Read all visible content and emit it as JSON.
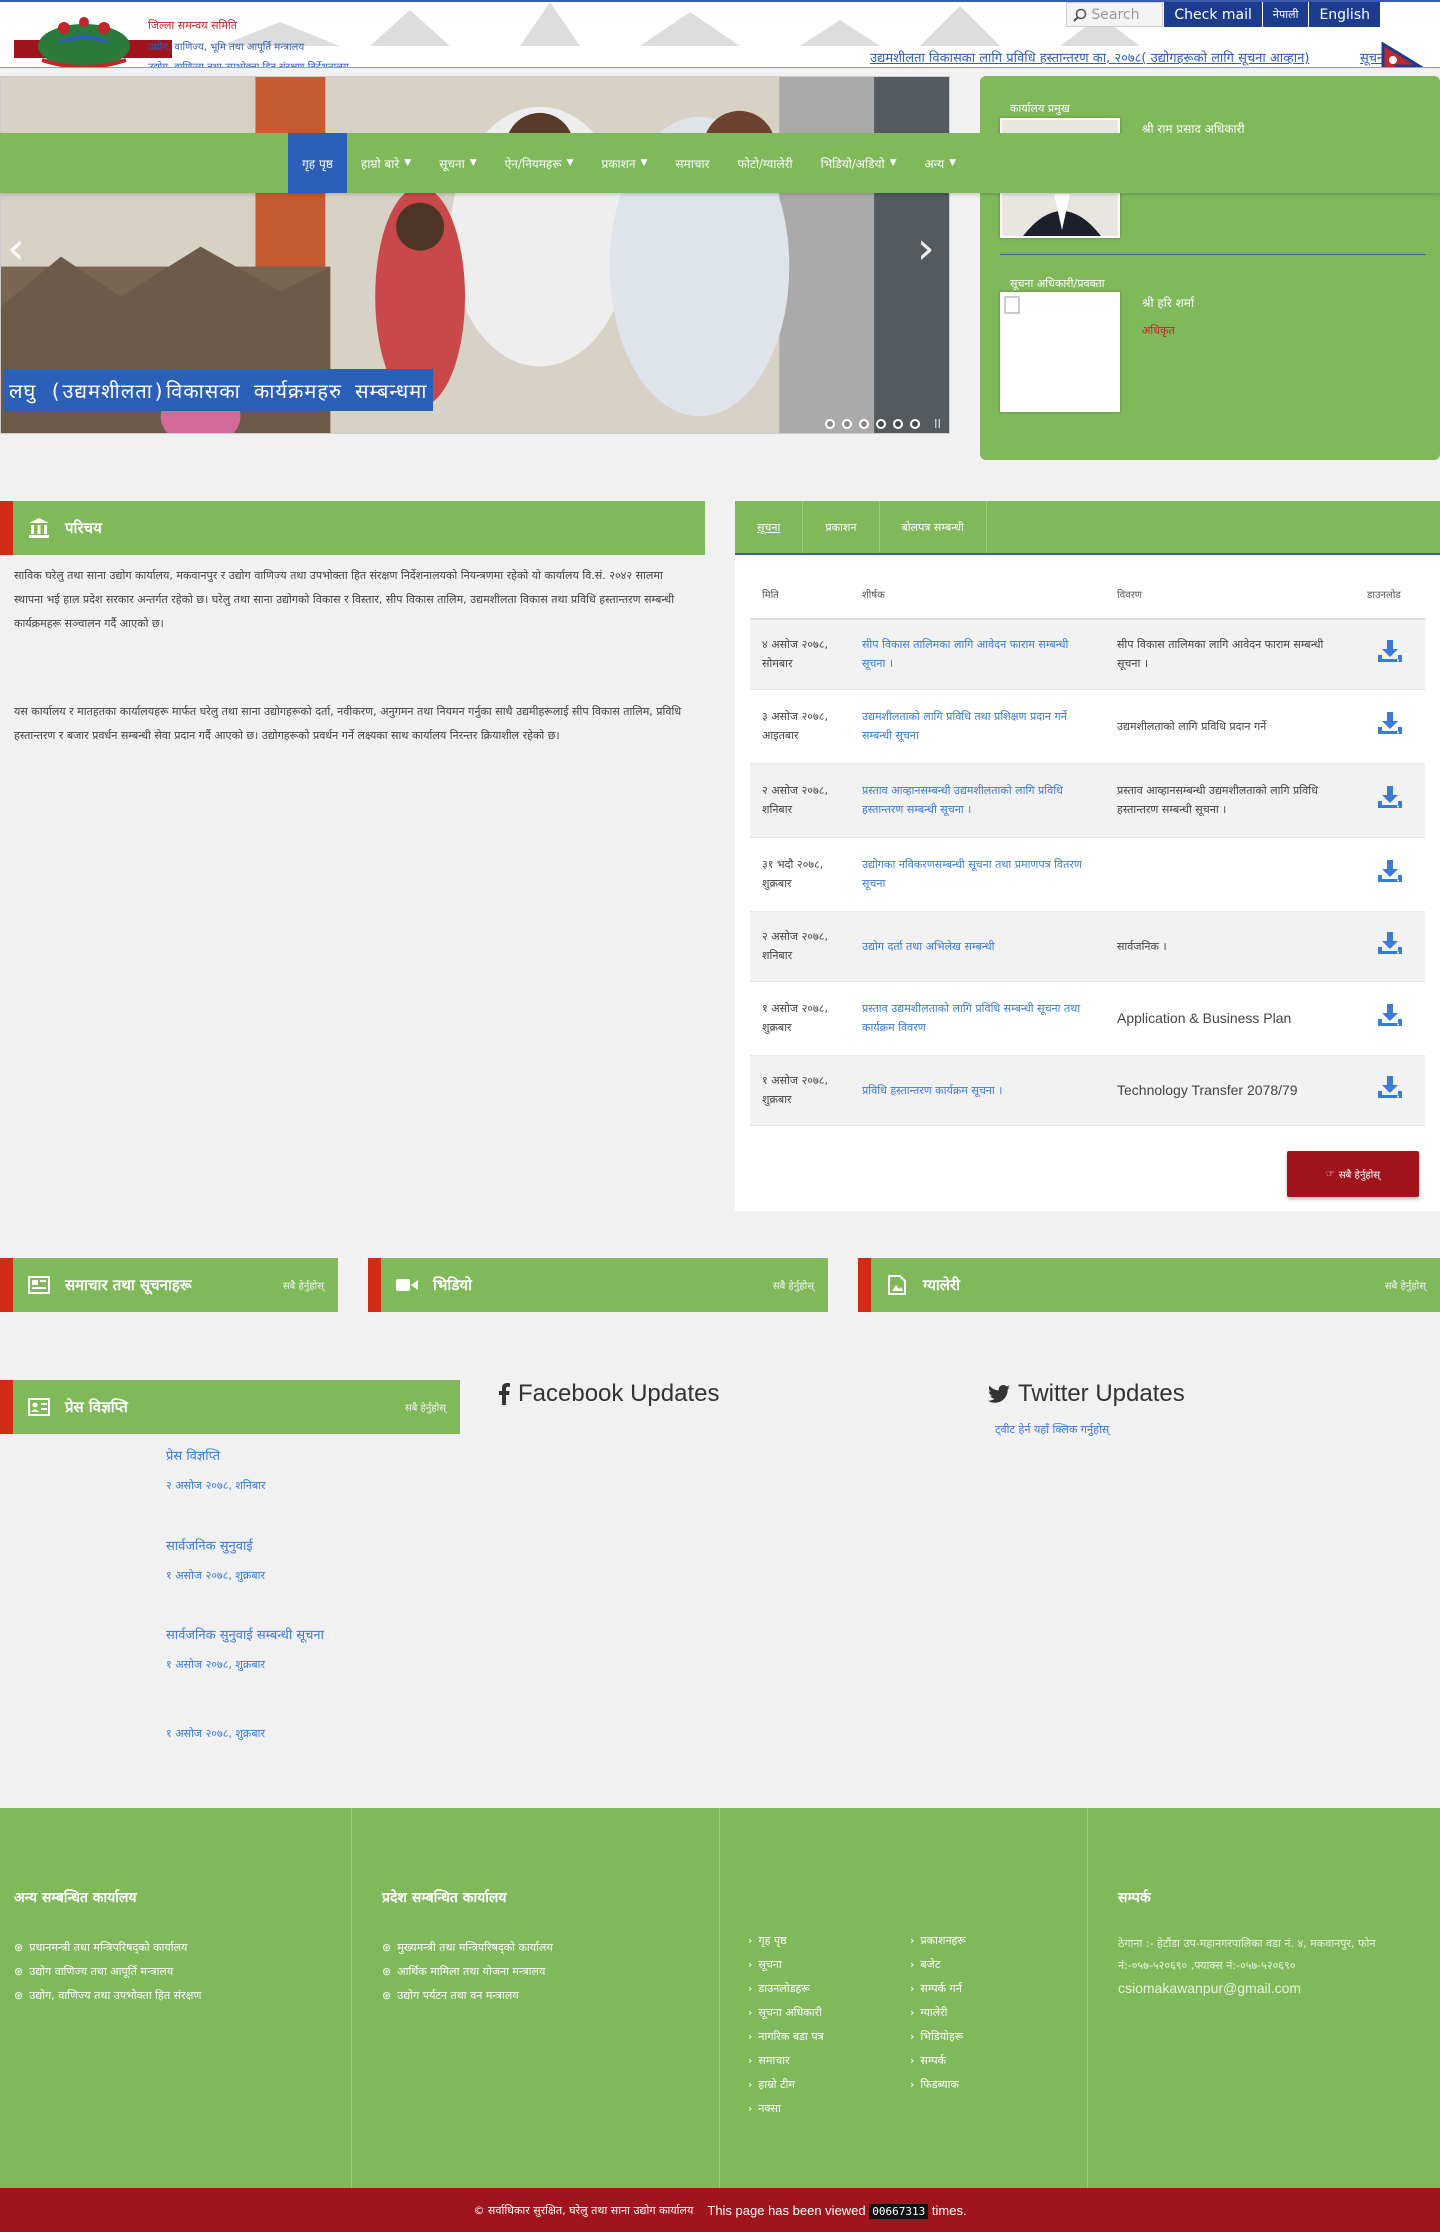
{
  "header": {
    "office_name": "जिल्ला समन्वय समिति",
    "office_sub1": "उद्योग, वाणिज्य, भूमि तथा आपूर्ति मन्त्रालय",
    "office_sub2": "उद्योग, वाणिज्य तथा उपभोक्ता हित संरक्षण निर्देशनालय",
    "search_placeholder": "Search",
    "check_mail": "Check mail",
    "lang_np": "नेपाली",
    "lang_en": "English",
    "ticker": "उद्यमशीलता विकासका लागि प्रविधि हस्तान्तरण का, २०७८( उद्योगहरूको लागि सूचना आव्हान)",
    "ticker2": "सूचना"
  },
  "nav": {
    "items": [
      {
        "label": "गृह पृष्ठ",
        "caret": false,
        "active": true
      },
      {
        "label": "हाम्रो बारे",
        "caret": true,
        "active": false
      },
      {
        "label": "सूचना",
        "caret": true,
        "active": false
      },
      {
        "label": "ऐन/नियमहरू",
        "caret": true,
        "active": false
      },
      {
        "label": "प्रकाशन",
        "caret": true,
        "active": false
      },
      {
        "label": "समाचार",
        "caret": false,
        "active": false
      },
      {
        "label": "फोटो/ग्यालेरी",
        "caret": false,
        "active": false
      },
      {
        "label": "भिडियो/अडियो",
        "caret": true,
        "active": false
      },
      {
        "label": "अन्य",
        "caret": true,
        "active": false
      }
    ]
  },
  "slider": {
    "caption": "लघु (उद्यमशीलता)विकासका कार्यक्रमहरु सम्बन्धमा",
    "prev_icon": "‹",
    "next_icon": "›",
    "pause_icon": "II"
  },
  "officials": [
    {
      "role": "कार्यालय प्रमुख",
      "name": "श्री राम प्रसाद अधिकारी",
      "title": ""
    },
    {
      "role": "सूचना अधिकारी/प्रवक्ता",
      "name": "श्री हरि शर्मा",
      "title": "अधिकृत"
    }
  ],
  "intro": {
    "title": "परिचय",
    "p1": "साविक घरेलु तथा साना उद्योग कार्यालय, मकवानपुर र उद्योग वाणिज्य तथा उपभोक्ता हित संरक्षण निर्देशनालयको नियन्त्रणमा रहेको यो कार्यालय वि.सं. २०४२ सालमा स्थापना भई हाल प्रदेश सरकार अन्तर्गत रहेको छ। घरेलु तथा साना उद्योगको विकास र विस्तार, सीप विकास तालिम, उद्यमशीलता विकास तथा प्रविधि हस्तान्तरण सम्बन्धी कार्यक्रमहरू सञ्चालन गर्दै आएको छ।",
    "p2": "यस कार्यालय र मातहतका कार्यालयहरू मार्फत घरेलु तथा साना उद्योगहरूको दर्ता, नवीकरण, अनुगमन तथा नियमन गर्नुका साथै उद्यमीहरूलाई सीप विकास तालिम, प्रविधि हस्तान्तरण र बजार प्रवर्धन सम्बन्धी सेवा प्रदान गर्दै आएको छ। उद्योगहरूको प्रवर्धन गर्ने लक्ष्यका साथ कार्यालय निरन्तर क्रियाशील रहेको छ।"
  },
  "docs": {
    "tabs": [
      "सूचना",
      "प्रकाशन",
      "बोलपत्र सम्बन्धी"
    ],
    "headers": [
      "मिति",
      "शीर्षक",
      "विवरण",
      "डाउनलोड"
    ],
    "rows": [
      {
        "date": "४ असोज २०७८, सोमबार",
        "title": "सीप विकास तालिमका लागि आवेदन फाराम सम्बन्धी सूचना ।",
        "desc": "सीप विकास तालिमका लागि आवेदन फाराम सम्बन्धी सूचना ।"
      },
      {
        "date": "३ असोज २०७८, आइतबार",
        "title": "उद्यमशीलताको लागि प्रविधि तथा प्रशिक्षण प्रदान गर्ने सम्बन्धी सूचना",
        "desc": "उद्यमशीलताको लागि प्रविधि प्रदान गर्ने"
      },
      {
        "date": "२ असोज २०७८, शनिबार",
        "title": "प्रस्ताव आव्हानसम्बन्धी उद्यमशीलताको लागि प्रविधि हस्तान्तरण सम्बन्धी सूचना ।",
        "desc": "प्रस्ताव आव्हानसम्बन्धी उद्यमशीलताको लागि प्रविधि हस्तान्तरण सम्बन्धी सूचना ।"
      },
      {
        "date": "३१ भदौ २०७८, शुक्रबार",
        "title": "उद्योगका नविकरणसम्बन्धी सूचना तथा प्रमाणपत्र वितरण सूचना",
        "desc": ""
      },
      {
        "date": "२ असोज २०७८, शनिबार",
        "title": "उद्योग दर्ता तथा अभिलेख सम्बन्धी",
        "desc": "सार्वजनिक ।"
      },
      {
        "date": "१ असोज २०७८, शुक्रबार",
        "title": "प्रस्ताव उद्यमशीलताको लागि प्रविधि सम्बन्धी सूचना तथा कार्यक्रम विवरण",
        "desc": "Application & Business Plan"
      },
      {
        "date": "१ असोज २०७८, शुक्रबार",
        "title": "प्रविधि हस्तान्तरण कार्यक्रम सूचना ।",
        "desc": "Technology Transfer 2078/79"
      }
    ],
    "view_all": "सबै हेर्नुहोस्"
  },
  "news": {
    "title": "समाचार तथा सूचनाहरू",
    "more": "सबै हेर्नुहोस्"
  },
  "video": {
    "title": "भिडियो",
    "more": "सबै हेर्नुहोस्"
  },
  "gallery": {
    "title": "ग्यालेरी",
    "more": "सबै हेर्नुहोस्"
  },
  "press": {
    "title": "प्रेस विज्ञप्ति",
    "more": "सबै हेर्नुहोस्",
    "items": [
      {
        "title": "प्रेस विज्ञप्ति",
        "date": "२ असोज २०७८, शनिबार"
      },
      {
        "title": "सार्वजनिक सुनुवाई",
        "date": "१ असोज २०७८, शुक्रबार"
      },
      {
        "title": "सार्वजनिक सुनुवाई सम्बन्धी सूचना",
        "date": "१ असोज २०७८, शुक्रबार"
      },
      {
        "title": "",
        "date": "१ असोज २०७८, शुक्रबार"
      }
    ]
  },
  "facebook": {
    "title": "Facebook Updates"
  },
  "twitter": {
    "title": "Twitter Updates",
    "link": "ट्वीट हेर्न यहाँ क्लिक गर्नुहोस्"
  },
  "footer": {
    "col1_title": "अन्य सम्बन्धित कार्यालय",
    "col1_links": [
      "प्रधानमन्त्री तथा मन्त्रिपरिषद्को कार्यालय",
      "उद्योग वाणिज्य तथा आपूर्ति मन्त्रालय",
      "उद्योग, वाणिज्य तथा उपभोक्ता हित संरक्षण"
    ],
    "col2_title": "प्रदेश सम्बन्धित कार्यालय",
    "col2_links": [
      "मुख्यमन्त्री तथा मन्त्रिपरिषद्को कार्यालय",
      "आर्थिक मामिला तथा योजना मन्त्रालय",
      "उद्योग पर्यटन तथा वन मन्त्रालय"
    ],
    "col3_links": [
      "गृह पृष्ठ",
      "सूचना",
      "डाउनलोडहरू",
      "सूचना अधिकारी",
      "नागरिक बडा पत्र",
      "समाचार",
      "हाम्रो टीम",
      "नक्सा"
    ],
    "col4_links": [
      "प्रकाशनहरू",
      "बजेट",
      "सम्पर्क गर्न",
      "ग्यालेरी",
      "भिडियोहरू",
      "सम्पर्क",
      "फिडब्याक"
    ],
    "col5_title": "सम्पर्क",
    "contact": "ठेगाना :- हेटौंडा उप-महानगरपालिका वडा नं. ४, मकवानपुर, फोन नं:-०५७-५२०६९० ,फ्याक्स नं:-०५७-५२०६९०",
    "email": "csiomakawanpur@gmail.com"
  },
  "bottom": {
    "copyright": "© सर्वाधिकार सुरक्षित, घरेलु तथा साना उद्योग कार्यालय",
    "viewed_prefix": "This page has been viewed",
    "count": "00667313",
    "viewed_suffix": "times."
  },
  "colors": {
    "green": "#7fb95a",
    "blue": "#2c5fb7",
    "red": "#d22b14",
    "maroon": "#a0141e"
  }
}
